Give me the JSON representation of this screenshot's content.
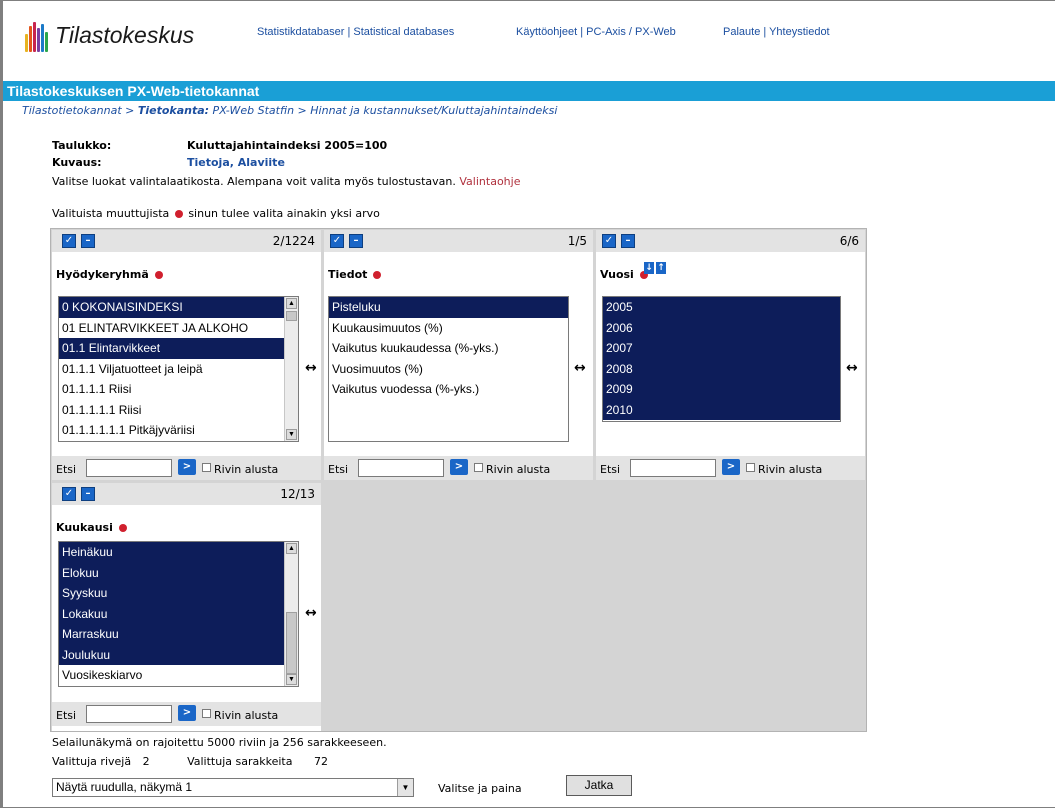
{
  "header": {
    "logo_text": "Tilastokeskus",
    "links": {
      "databases": "Statistikdatabaser | Statistical databases",
      "help": "Käyttöohjeet | PC-Axis / PX-Web",
      "feedback": "Palaute | Yhteystiedot"
    }
  },
  "banner": {
    "title": "Tilastokeskuksen PX-Web-tietokannat"
  },
  "breadcrumb": {
    "root": "Tilastotietokannat",
    "sep1": " > ",
    "db_label": "Tietokanta:",
    "db_name": " PX-Web Statfin",
    "sep2": " > ",
    "path": "Hinnat ja kustannukset/Kuluttajahintaindeksi"
  },
  "info": {
    "table_label": "Taulukko:",
    "table_value": "Kuluttajahintaindeksi 2005=100",
    "desc_label": "Kuvaus:",
    "desc_link1": "Tietoja",
    "desc_sep": ", ",
    "desc_link2": "Alaviite",
    "instruction": "Valitse luokat valintalaatikosta. Alempana voit valita myös tulostustavan. ",
    "instruction_link": "Valintaohje",
    "required_pre": "Valituista muuttujista",
    "required_post": "sinun tulee valita ainakin yksi arvo"
  },
  "panels": [
    {
      "count": "2/1224",
      "name": "Hyödykeryhmä",
      "items": [
        {
          "label": "0 KOKONAISINDEKSI",
          "selected": true
        },
        {
          "label": "01 ELINTARVIKKEET JA ALKOHO",
          "selected": false
        },
        {
          "label": "01.1 Elintarvikkeet",
          "selected": true
        },
        {
          "label": "01.1.1 Viljatuotteet ja leipä",
          "selected": false
        },
        {
          "label": "01.1.1.1 Riisi",
          "selected": false
        },
        {
          "label": "01.1.1.1.1 Riisi",
          "selected": false
        },
        {
          "label": "01.1.1.1.1.1 Pitkäjyväriisi",
          "selected": false
        }
      ]
    },
    {
      "count": "1/5",
      "name": "Tiedot",
      "items": [
        {
          "label": "Pisteluku",
          "selected": true
        },
        {
          "label": "Kuukausimuutos (%)",
          "selected": false
        },
        {
          "label": "Vaikutus kuukaudessa (%-yks.)",
          "selected": false
        },
        {
          "label": "Vuosimuutos (%)",
          "selected": false
        },
        {
          "label": "Vaikutus vuodessa (%-yks.)",
          "selected": false
        }
      ]
    },
    {
      "count": "6/6",
      "name": "Vuosi",
      "items": [
        {
          "label": "2005",
          "selected": true
        },
        {
          "label": "2006",
          "selected": true
        },
        {
          "label": "2007",
          "selected": true
        },
        {
          "label": "2008",
          "selected": true
        },
        {
          "label": "2009",
          "selected": true
        },
        {
          "label": "2010",
          "selected": true
        }
      ]
    },
    {
      "count": "12/13",
      "name": "Kuukausi",
      "items": [
        {
          "label": "Heinäkuu",
          "selected": true
        },
        {
          "label": "Elokuu",
          "selected": true
        },
        {
          "label": "Syyskuu",
          "selected": true
        },
        {
          "label": "Lokakuu",
          "selected": true
        },
        {
          "label": "Marraskuu",
          "selected": true
        },
        {
          "label": "Joulukuu",
          "selected": true
        },
        {
          "label": "Vuosikeskiarvo",
          "selected": false
        }
      ]
    }
  ],
  "search": {
    "label": "Etsi",
    "checkbox_label": "Rivin alusta"
  },
  "footer": {
    "limit_text": "Selailunäkymä on rajoitettu 5000 riviin ja 256 sarakkeeseen.",
    "rows_label": "Valittuja rivejä",
    "rows_value": "2",
    "cols_label": "Valittuja sarakkeita",
    "cols_value": "72",
    "view_select": "Näytä ruudulla, näkymä 1",
    "choose_text": "Valitse ja paina",
    "continue_button": "Jatka"
  },
  "colors": {
    "banner": "#1a9fd6",
    "selected": "#0d1d5a",
    "link": "#1c4fa0",
    "required_dot": "#d0202e"
  }
}
